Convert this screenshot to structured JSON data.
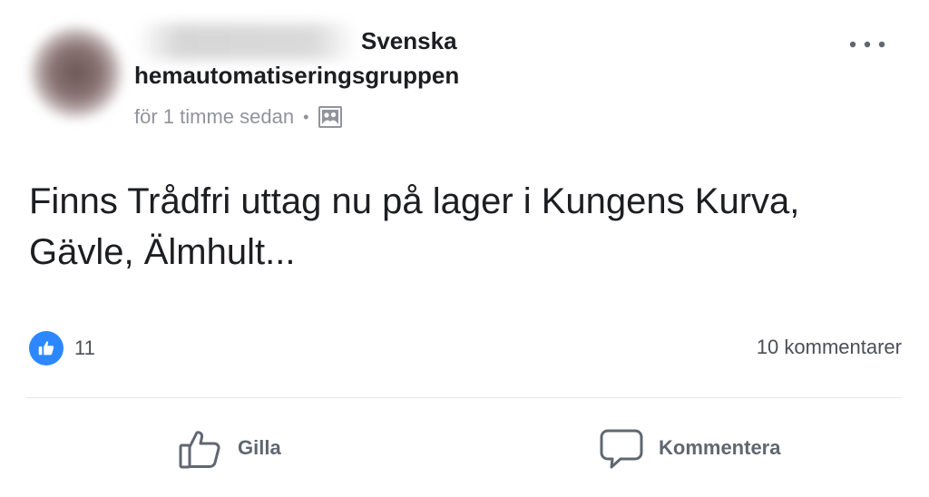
{
  "post": {
    "group_name_line1": "Svenska",
    "group_name_line2": "hemautomatiseringsgruppen",
    "time": "för 1 timme sedan",
    "separator": "•",
    "text": "Finns Trådfri uttag nu på lager i Kungens Kurva, Gävle, Älmhult...",
    "icons": {
      "more": "more-options-icon",
      "audience": "photo-icon"
    }
  },
  "reactions": {
    "like_count": "11",
    "comment_count": "10 kommentarer",
    "like_color": "#2d88ff"
  },
  "actions": {
    "like_label": "Gilla",
    "comment_label": "Kommentera"
  }
}
